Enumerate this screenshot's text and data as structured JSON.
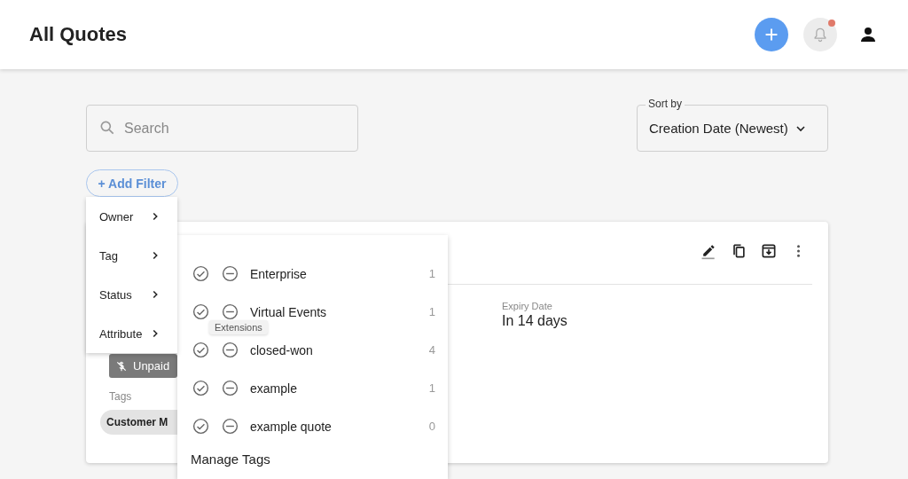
{
  "header": {
    "title": "All Quotes",
    "notification_unread": true
  },
  "search": {
    "placeholder": "Search"
  },
  "sort": {
    "label": "Sort by",
    "value": "Creation Date (Newest)"
  },
  "add_filter": {
    "label": "+ Add Filter"
  },
  "filter_menu": {
    "items": [
      {
        "label": "Owner"
      },
      {
        "label": "Tag"
      },
      {
        "label": "Status"
      },
      {
        "label": "Attribute"
      }
    ]
  },
  "tag_menu": {
    "items": [
      {
        "label": "Enterprise",
        "count": "1"
      },
      {
        "label": "Virtual Events",
        "count": "1"
      },
      {
        "label": "closed-won",
        "count": "4"
      },
      {
        "label": "example",
        "count": "1"
      },
      {
        "label": "example quote",
        "count": "0"
      }
    ],
    "footer": "Manage Tags"
  },
  "tooltip": "Extensions",
  "quote_card": {
    "expiry_label": "Expiry Date",
    "expiry_value": "In 14 days",
    "payment_badge": "Unpaid",
    "tags_label": "Tags",
    "tags": [
      "Customer M"
    ]
  }
}
